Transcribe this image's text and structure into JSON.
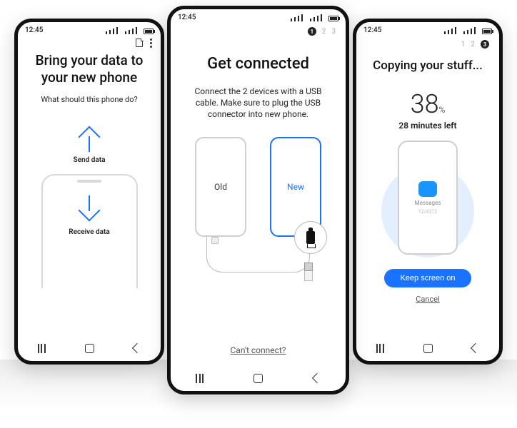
{
  "status_time": "12:45",
  "left": {
    "title": "Bring your data to your new phone",
    "subtitle": "What should this phone do?",
    "send": "Send data",
    "receive": "Receive data"
  },
  "center": {
    "steps": [
      "1",
      "2",
      "3"
    ],
    "title": "Get connected",
    "subtitle": "Connect the 2 devices with a USB cable. Make sure to plug the USB connector into new phone.",
    "old": "Old",
    "new": "New",
    "cant": "Can't connect?"
  },
  "right": {
    "steps": [
      "1",
      "2",
      "3"
    ],
    "title": "Copying your stuff...",
    "percent": "38",
    "percent_suffix": "%",
    "remaining": "28 minutes left",
    "category": "Messages",
    "progress": "12/4372",
    "keep": "Keep screen on",
    "cancel": "Cancel"
  }
}
